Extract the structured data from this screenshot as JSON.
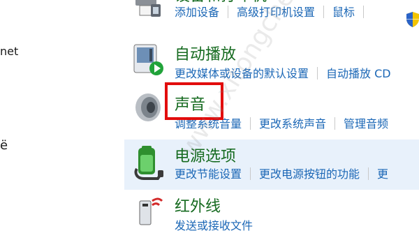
{
  "left_panel": {
    "item1": "net",
    "item2": "ë"
  },
  "rows": {
    "devices": {
      "title": "设备和打印机",
      "links": [
        "添加设备",
        "高级打印机设置",
        "鼠标"
      ]
    },
    "autoplay": {
      "title": "自动播放",
      "links": [
        "更改媒体或设备的默认设置",
        "自动播放 CD"
      ]
    },
    "sound": {
      "title": "声音",
      "links": [
        "调整系统音量",
        "更改系统声音",
        "管理音频"
      ]
    },
    "power": {
      "title": "电源选项",
      "links": [
        "更改节能设置",
        "更改电源按钮的功能",
        "更"
      ]
    },
    "infrared": {
      "title": "红外线",
      "links": [
        "发送或接收文件"
      ]
    }
  },
  "watermark": "www.xitongcheng.com",
  "colors": {
    "title": "#156a1f",
    "link": "#1b67b6",
    "highlight": "#e20d0d",
    "hover_row": "#e8f1fb"
  }
}
